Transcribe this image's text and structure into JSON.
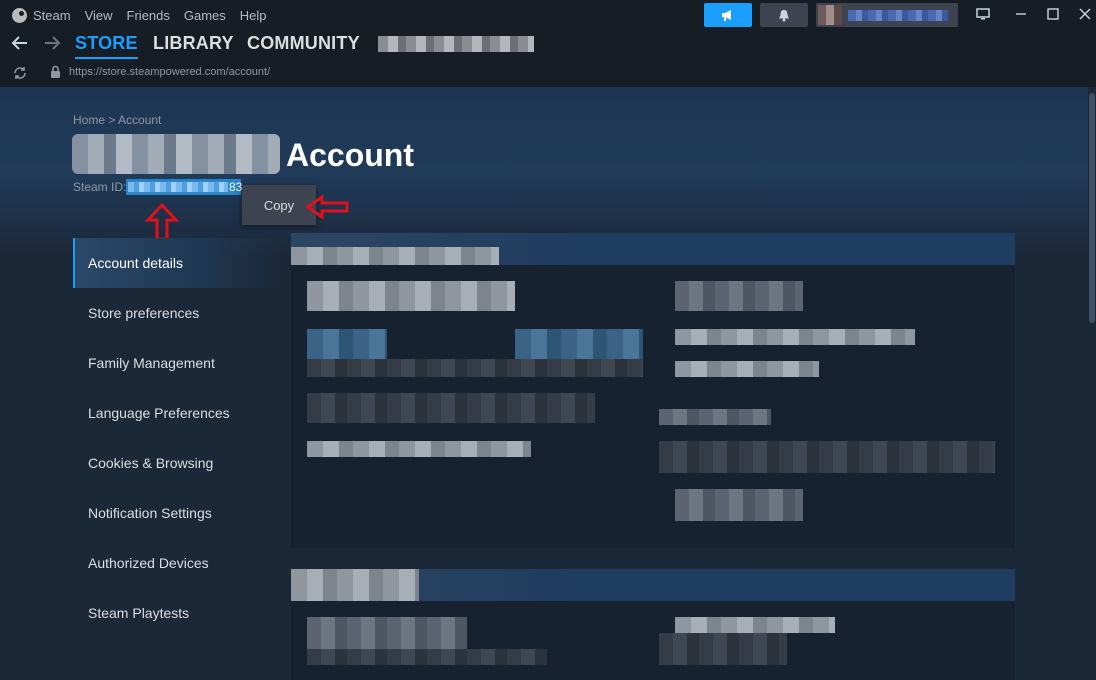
{
  "titlebar": {
    "menu": [
      "Steam",
      "View",
      "Friends",
      "Games",
      "Help"
    ],
    "window_controls": [
      "monitor-icon",
      "minimize-icon",
      "maximize-icon",
      "close-icon"
    ]
  },
  "navbar": {
    "tabs": [
      "STORE",
      "LIBRARY",
      "COMMUNITY"
    ],
    "active_tab": "STORE"
  },
  "urlbar": {
    "url": "https://store.steampowered.com/account/"
  },
  "page": {
    "breadcrumb": "Home > Account",
    "title": "Account",
    "steam_id_label": "Steam ID:",
    "steam_id_visible_suffix": "83",
    "context_menu_copy": "Copy"
  },
  "sidebar": {
    "items": [
      {
        "label": "Account details",
        "active": true
      },
      {
        "label": "Store preferences"
      },
      {
        "label": "Family Management"
      },
      {
        "label": "Language Preferences"
      },
      {
        "label": "Cookies & Browsing"
      },
      {
        "label": "Notification Settings"
      },
      {
        "label": "Authorized Devices"
      },
      {
        "label": "Steam Playtests"
      }
    ]
  },
  "colors": {
    "accent": "#1a9fff",
    "background": "#171d25",
    "content_bg": "#1b2838",
    "annotation_arrow": "#e0101a"
  }
}
